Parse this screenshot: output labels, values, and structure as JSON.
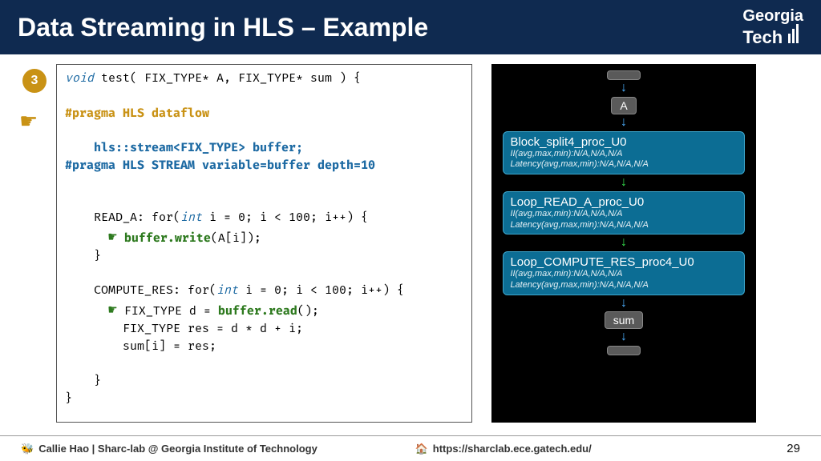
{
  "header": {
    "title": "Data Streaming in HLS – Example",
    "logo_l1": "Georgia",
    "logo_l2": "Tech"
  },
  "badge": "3",
  "code": {
    "sig_kw": "void",
    "sig_rest": " test( FIX_TYPE* A, FIX_TYPE* sum ) {",
    "pragma1": "#pragma HLS dataflow",
    "stream_decl_a": "hls::stream<FIX_TYPE>",
    "stream_decl_b": " buffer;",
    "pragma2": "#pragma HLS STREAM variable=buffer depth=10",
    "loop1_a": "READ_A: for(",
    "loop1_kw": "int",
    "loop1_b": " i = 0; i < 100; i++) {",
    "write_a": "buffer.write",
    "write_b": "(A[i]);",
    "loop2_a": "COMPUTE_RES: for(",
    "loop2_kw": "int",
    "loop2_b": " i = 0; i < 100; i++) {",
    "read_a": "FIX_TYPE d = ",
    "read_b": "buffer.read",
    "read_c": "();",
    "res": "FIX_TYPE res = d * d + i;",
    "sum": "sum[i] = res;",
    "close1": "}",
    "close2": "}"
  },
  "graph": {
    "nA": "A",
    "p1": {
      "name": "Block_split4_proc_U0",
      "m1": "II(avg,max,min):N/A,N/A,N/A",
      "m2": "Latency(avg,max,min):N/A,N/A,N/A"
    },
    "p2": {
      "name": "Loop_READ_A_proc_U0",
      "m1": "II(avg,max,min):N/A,N/A,N/A",
      "m2": "Latency(avg,max,min):N/A,N/A,N/A"
    },
    "p3": {
      "name": "Loop_COMPUTE_RES_proc4_U0",
      "m1": "II(avg,max,min):N/A,N/A,N/A",
      "m2": "Latency(avg,max,min):N/A,N/A,N/A"
    },
    "nSum": "sum"
  },
  "footer": {
    "author": "Callie Hao | Sharc-lab @ Georgia Institute of Technology",
    "url": "https://sharclab.ece.gatech.edu/",
    "page": "29"
  }
}
